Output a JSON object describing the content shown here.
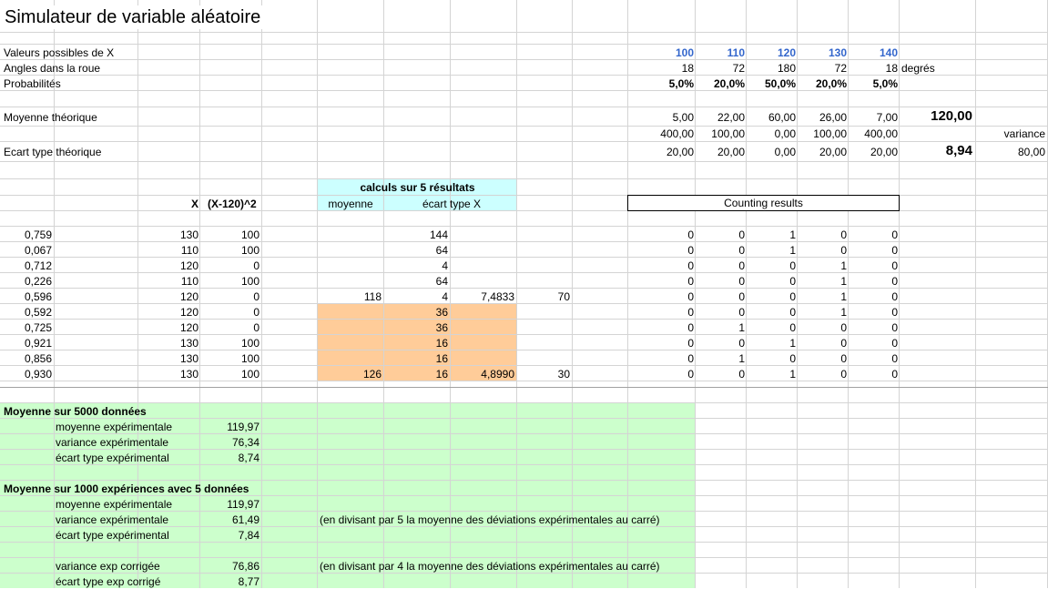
{
  "title": "Simulateur de variable aléatoire",
  "header_rows": {
    "values_label": "Valeurs possibles de X",
    "angles_label": "Angles dans la roue",
    "prob_label": "Probabilités",
    "values": [
      "100",
      "110",
      "120",
      "130",
      "140"
    ],
    "angles": [
      "18",
      "72",
      "180",
      "72",
      "18"
    ],
    "angles_unit": "degrés",
    "probs": [
      "5,0%",
      "20,0%",
      "50,0%",
      "20,0%",
      "5,0%"
    ]
  },
  "theory": {
    "mean_label": "Moyenne théorique",
    "mean_terms": [
      "5,00",
      "22,00",
      "60,00",
      "26,00",
      "7,00"
    ],
    "mean_value": "120,00",
    "sq_dev": [
      "400,00",
      "100,00",
      "0,00",
      "100,00",
      "400,00"
    ],
    "variance_label": "variance",
    "sd_label": "Ecart type théorique",
    "sd_terms": [
      "20,00",
      "20,00",
      "0,00",
      "20,00",
      "20,00"
    ],
    "sd_value": "8,94",
    "variance_value": "80,00"
  },
  "table": {
    "col_x": "X",
    "col_sq": "(X-120)^2",
    "calc_title": "calculs sur 5 résultats",
    "col_mean": "moyenne",
    "col_sd": "écart type X",
    "counting_label": "Counting results",
    "rows": [
      {
        "u": "0,759",
        "x": "130",
        "sq": "100",
        "m": "",
        "d": "144",
        "s": "",
        "n": "",
        "cnt": [
          "0",
          "0",
          "1",
          "0",
          "0"
        ]
      },
      {
        "u": "0,067",
        "x": "110",
        "sq": "100",
        "m": "",
        "d": "64",
        "s": "",
        "n": "",
        "cnt": [
          "0",
          "0",
          "1",
          "0",
          "0"
        ]
      },
      {
        "u": "0,712",
        "x": "120",
        "sq": "0",
        "m": "",
        "d": "4",
        "s": "",
        "n": "",
        "cnt": [
          "0",
          "0",
          "0",
          "1",
          "0"
        ]
      },
      {
        "u": "0,226",
        "x": "110",
        "sq": "100",
        "m": "",
        "d": "64",
        "s": "",
        "n": "",
        "cnt": [
          "0",
          "0",
          "0",
          "1",
          "0"
        ]
      },
      {
        "u": "0,596",
        "x": "120",
        "sq": "0",
        "m": "118",
        "d": "4",
        "s": "7,4833",
        "n": "70",
        "cnt": [
          "0",
          "0",
          "0",
          "1",
          "0"
        ]
      },
      {
        "u": "0,592",
        "x": "120",
        "sq": "0",
        "m": "",
        "d": "36",
        "s": "",
        "n": "",
        "cnt": [
          "0",
          "0",
          "0",
          "1",
          "0"
        ]
      },
      {
        "u": "0,725",
        "x": "120",
        "sq": "0",
        "m": "",
        "d": "36",
        "s": "",
        "n": "",
        "cnt": [
          "0",
          "1",
          "0",
          "0",
          "0"
        ]
      },
      {
        "u": "0,921",
        "x": "130",
        "sq": "100",
        "m": "",
        "d": "16",
        "s": "",
        "n": "",
        "cnt": [
          "0",
          "0",
          "1",
          "0",
          "0"
        ]
      },
      {
        "u": "0,856",
        "x": "130",
        "sq": "100",
        "m": "",
        "d": "16",
        "s": "",
        "n": "",
        "cnt": [
          "0",
          "1",
          "0",
          "0",
          "0"
        ]
      },
      {
        "u": "0,930",
        "x": "130",
        "sq": "100",
        "m": "126",
        "d": "16",
        "s": "4,8990",
        "n": "30",
        "cnt": [
          "0",
          "0",
          "1",
          "0",
          "0"
        ]
      }
    ]
  },
  "summary": {
    "s1_title": "Moyenne sur 5000 données",
    "s1_mean_label": "moyenne expérimentale",
    "s1_mean": "119,97",
    "s1_var_label": "variance expérimentale",
    "s1_var": "76,34",
    "s1_sd_label": "écart type expérimental",
    "s1_sd": "8,74",
    "s2_title": "Moyenne sur 1000 expériences avec 5 données",
    "s2_mean_label": "moyenne expérimentale",
    "s2_mean": "119,97",
    "s2_var_label": "variance expérimentale",
    "s2_var": "61,49",
    "s2_var_note": "(en divisant par 5 la moyenne des déviations expérimentales au carré)",
    "s2_sd_label": "écart type expérimental",
    "s2_sd": "7,84",
    "s2_cvar_label": "variance exp corrigée",
    "s2_cvar": "76,86",
    "s2_cvar_note": "(en divisant par 4 la moyenne des déviations expérimentales au carré)",
    "s2_csd_label": "écart type exp corrigé",
    "s2_csd": "8,77"
  },
  "colors": {
    "grid": "#d4d4d4",
    "cyan": "#ccffff",
    "orange": "#ffcc99",
    "green": "#ccffcc",
    "blue_text": "#3366cc"
  }
}
